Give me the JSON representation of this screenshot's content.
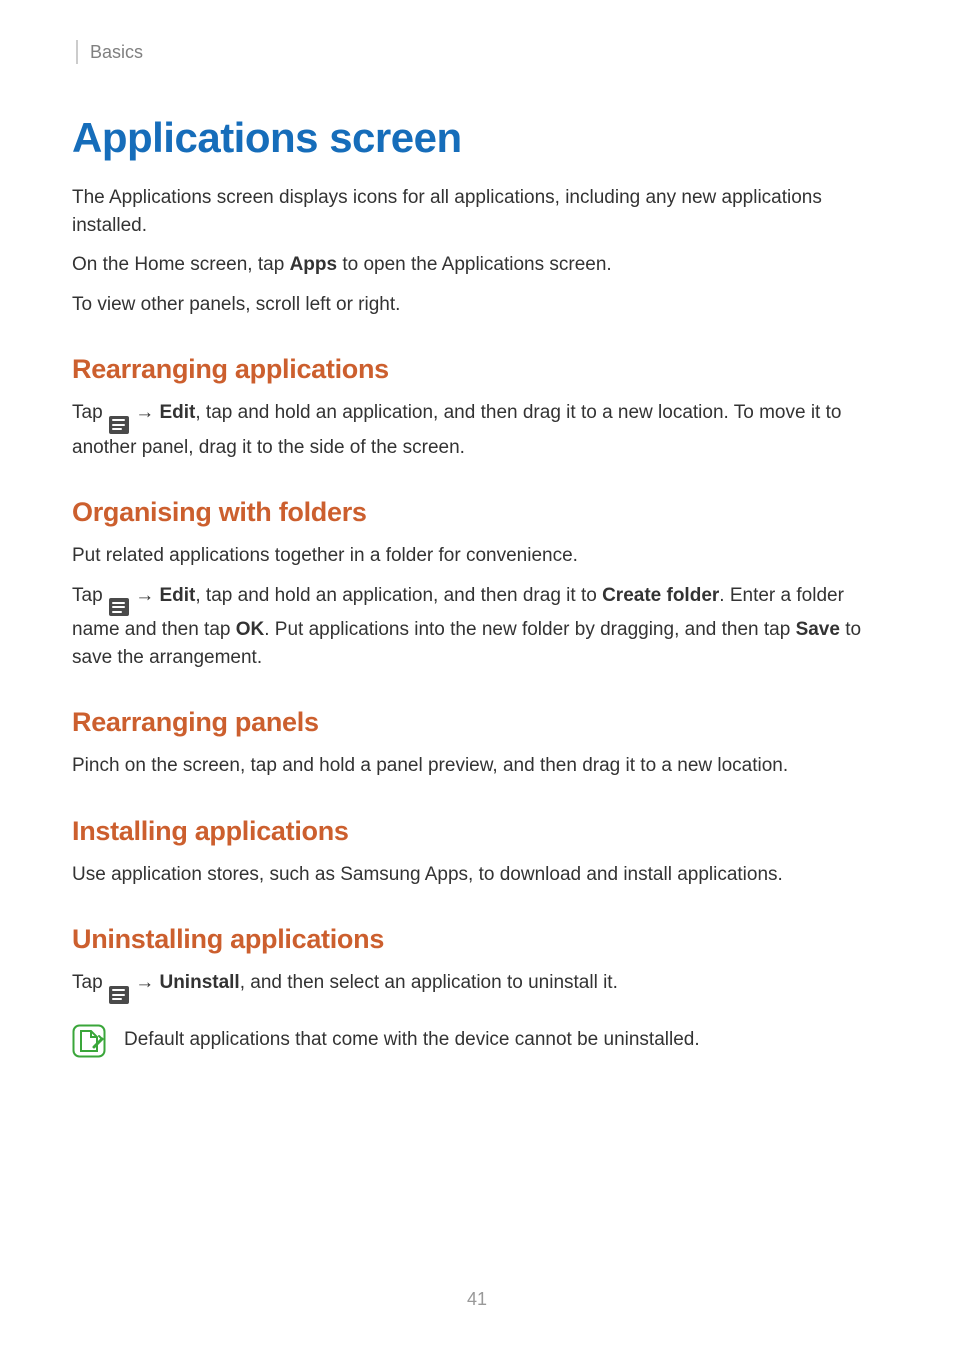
{
  "breadcrumb": "Basics",
  "main_heading": "Applications screen",
  "intro": {
    "p1": "The Applications screen displays icons for all applications, including any new applications installed.",
    "p2_pre": "On the Home screen, tap ",
    "p2_bold": "Apps",
    "p2_post": " to open the Applications screen.",
    "p3": "To view other panels, scroll left or right."
  },
  "sections": {
    "rearranging_apps": {
      "heading": "Rearranging applications",
      "pre": "Tap ",
      "arrow": " → ",
      "bold1": "Edit",
      "post": ", tap and hold an application, and then drag it to a new location. To move it to another panel, drag it to the side of the screen."
    },
    "organising_folders": {
      "heading": "Organising with folders",
      "p1": "Put related applications together in a folder for convenience.",
      "pre": "Tap ",
      "arrow": " → ",
      "bold1": "Edit",
      "mid1": ", tap and hold an application, and then drag it to ",
      "bold2": "Create folder",
      "mid2": ". Enter a folder name and then tap ",
      "bold3": "OK",
      "mid3": ". Put applications into the new folder by dragging, and then tap ",
      "bold4": "Save",
      "post": " to save the arrangement."
    },
    "rearranging_panels": {
      "heading": "Rearranging panels",
      "body": "Pinch on the screen, tap and hold a panel preview, and then drag it to a new location."
    },
    "installing": {
      "heading": "Installing applications",
      "body": "Use application stores, such as Samsung Apps, to download and install applications."
    },
    "uninstalling": {
      "heading": "Uninstalling applications",
      "pre": "Tap ",
      "arrow": " → ",
      "bold1": "Uninstall",
      "post": ", and then select an application to uninstall it.",
      "note": "Default applications that come with the device cannot be uninstalled."
    }
  },
  "page_number": "41"
}
